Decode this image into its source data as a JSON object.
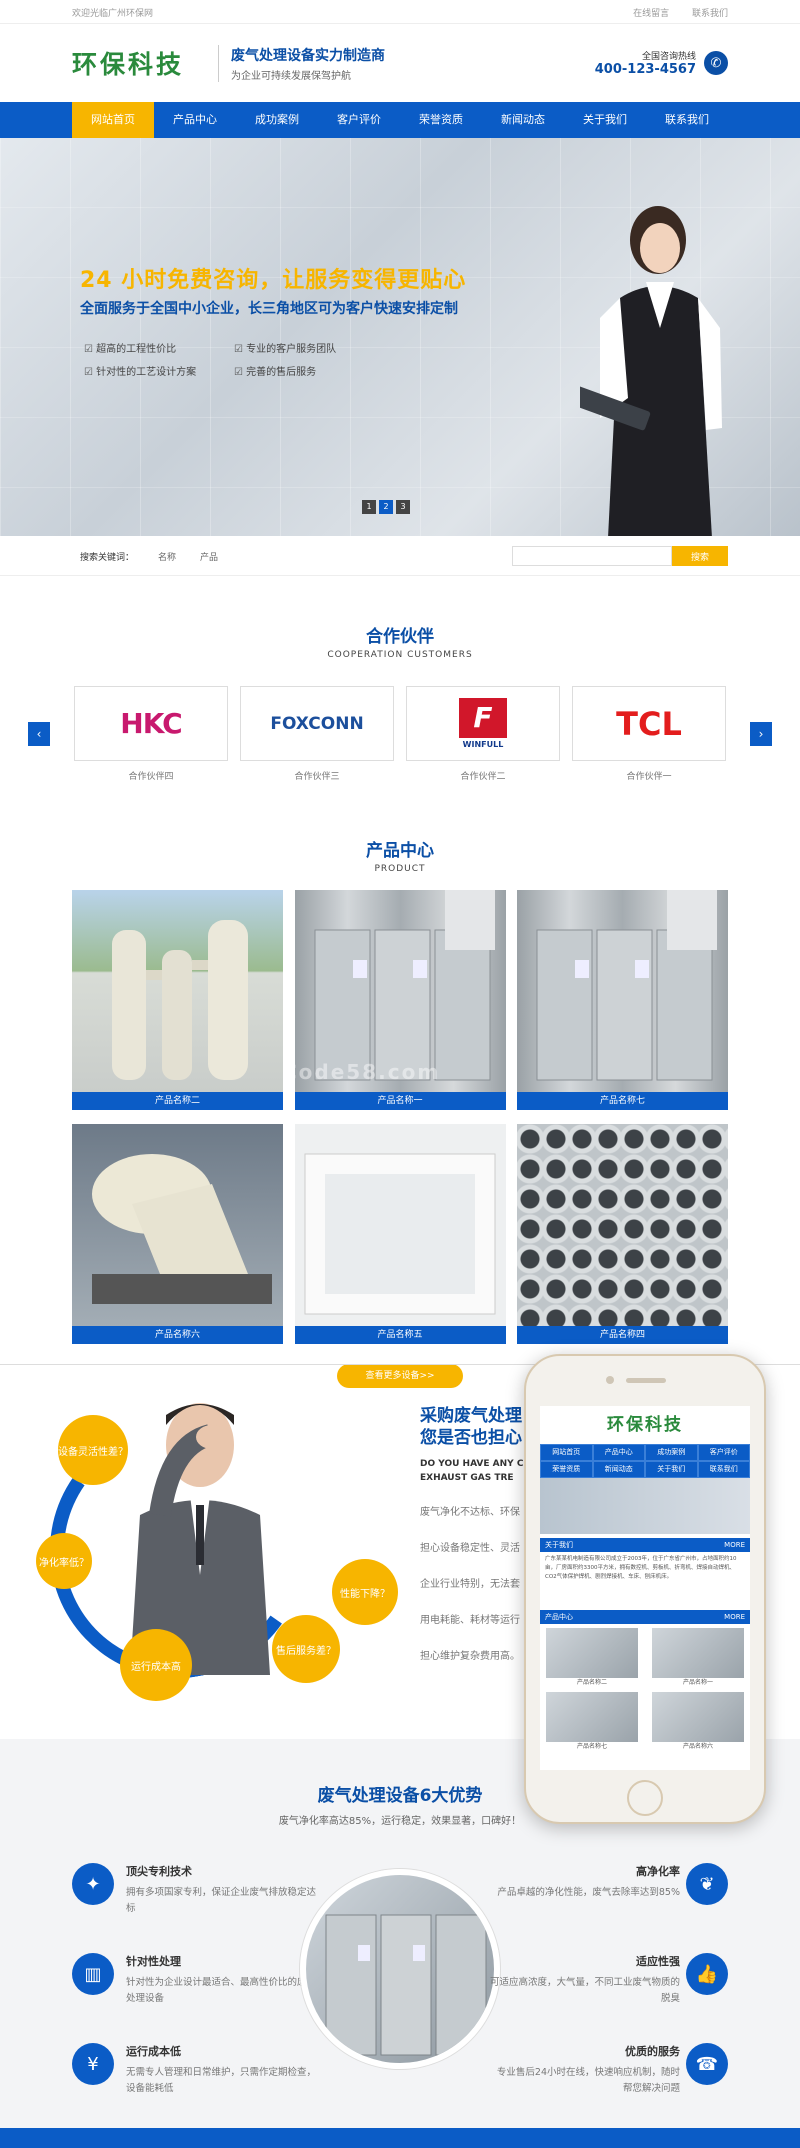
{
  "topbar": {
    "welcome": "欢迎光临广州环保网",
    "links": [
      "在线留言",
      "联系我们"
    ]
  },
  "header": {
    "logo": "环保科技",
    "slogan_main": "废气处理设备实力制造商",
    "slogan_sub": "为企业可持续发展保驾护航",
    "hotline_label": "全国咨询热线",
    "hotline_number": "400-123-4567",
    "icon": "phone-icon"
  },
  "nav": {
    "items": [
      "网站首页",
      "产品中心",
      "成功案例",
      "客户评价",
      "荣誉资质",
      "新闻动态",
      "关于我们",
      "联系我们"
    ],
    "active": 0
  },
  "banner": {
    "headline": "24 小时免费咨询，让服务变得更贴心",
    "subline": "全面服务于全国中小企业，长三角地区可为客户快速安排定制",
    "features": [
      "超高的工程性价比",
      "专业的客户服务团队",
      "针对性的工艺设计方案",
      "完善的售后服务"
    ],
    "pages": [
      "1",
      "2",
      "3"
    ],
    "active_page": 1
  },
  "search": {
    "label": "搜索关键词：",
    "keywords": [
      "名称",
      "产品"
    ],
    "placeholder": "",
    "button": "搜索"
  },
  "partners": {
    "title": "合作伙伴",
    "title_en": "COOPERATION CUSTOMERS",
    "prev": "‹",
    "next": "›",
    "items": [
      {
        "logo": "HKC",
        "caption": "合作伙伴四"
      },
      {
        "logo": "FOXCONN",
        "caption": "合作伙伴三"
      },
      {
        "logo": "F",
        "logo_sub": "WINFULL",
        "caption": "合作伙伴二"
      },
      {
        "logo": "TCL",
        "caption": "合作伙伴一"
      }
    ]
  },
  "products": {
    "title": "产品中心",
    "title_en": "PRODUCT",
    "items": [
      "产品名称二",
      "产品名称一",
      "产品名称七",
      "产品名称六",
      "产品名称五",
      "产品名称四"
    ],
    "more": "查看更多设备>>"
  },
  "watermark": "Code58.com",
  "problem": {
    "title_l1": "采购废气处理",
    "title_l2": "您是否也担心",
    "title_en_l1": "DO YOU HAVE ANY C",
    "title_en_l2": "EXHAUST GAS TRE",
    "lines": [
      "废气净化不达标、环保",
      "担心设备稳定性、灵活",
      "企业行业特别，无法套",
      "用电耗能、耗材等运行",
      "担心维护复杂费用高。"
    ],
    "bubbles": [
      "设备灵活性差？",
      "净化率低？",
      "运行成本高",
      "售后服务差？",
      "性能下降？"
    ]
  },
  "phone": {
    "logo": "环保科技",
    "nav": [
      "网站首页",
      "产品中心",
      "成功案例",
      "客户评价",
      "荣誉资质",
      "新闻动态",
      "关于我们",
      "联系我们"
    ],
    "about_title": "关于我们",
    "about_more": "MORE",
    "about_text": "广东某某机电制造有限公司成立于2003年，位于广东省广州市，占地面积约10亩，厂房面积约3300平方米，拥有数控机、剪板机、折弯机、焊接自动焊机、CO2气体保护焊机、剧烈焊接机、车床、刨床机床。",
    "product_title": "产品中心",
    "product_more": "MORE",
    "products": [
      "产品名称二",
      "产品名称一",
      "产品名称七",
      "产品名称六"
    ]
  },
  "advantages": {
    "title": "废气处理设备6大优势",
    "subtitle": "废气净化率高达85%，运行稳定，效果显著，口碑好！",
    "left": [
      {
        "title": "顶尖专利技术",
        "desc": "拥有多项国家专利，保证企业废气排放稳定达标",
        "icon": "patent-icon"
      },
      {
        "title": "针对性处理",
        "desc": "针对性为企业设计最适合、最高性价比的废气处理设备",
        "icon": "target-icon"
      },
      {
        "title": "运行成本低",
        "desc": "无需专人管理和日常维护，只需作定期检查，设备能耗低",
        "icon": "money-icon"
      }
    ],
    "right": [
      {
        "title": "高净化率",
        "desc": "产品卓越的净化性能，废气去除率达到85%",
        "icon": "leaf-icon"
      },
      {
        "title": "适应性强",
        "desc": "可适应高浓度，大气量，不同工业废气物质的脱臭",
        "icon": "thumb-icon"
      },
      {
        "title": "优质的服务",
        "desc": "专业售后24小时在线，快速响应机制，随时帮您解决问题",
        "icon": "service-icon"
      }
    ]
  },
  "colors": {
    "primary": "#0b5cc6",
    "accent": "#f7b500",
    "logo": "#2a8a3c"
  }
}
